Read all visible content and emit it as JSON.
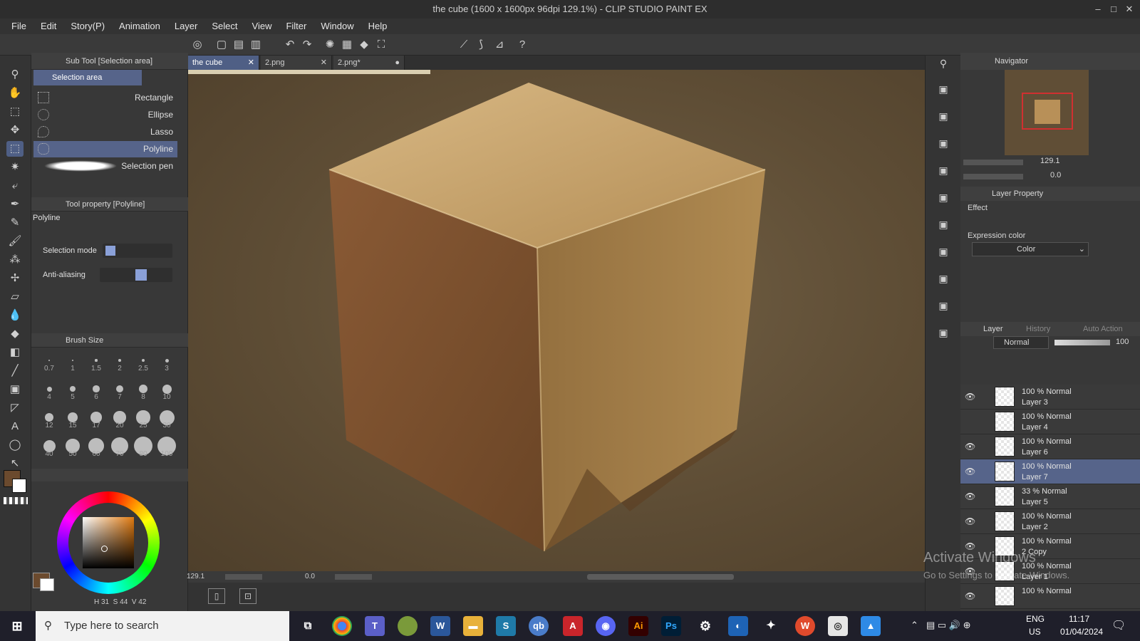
{
  "window": {
    "title": "the cube (1600 x 1600px 96dpi 129.1%)  - CLIP STUDIO PAINT EX",
    "controls": [
      "–",
      "□",
      "✕"
    ]
  },
  "menu": [
    "File",
    "Edit",
    "Story(P)",
    "Animation",
    "Layer",
    "Select",
    "View",
    "Filter",
    "Window",
    "Help"
  ],
  "subtool_panel": {
    "header": "Sub Tool [Selection area]",
    "group_tab": "Selection area",
    "items": [
      "Rectangle",
      "Ellipse",
      "Lasso",
      "Polyline",
      "Selection pen"
    ],
    "selected_index": 3
  },
  "tool_property": {
    "header": "Tool property [Polyline]",
    "tool_name": "Polyline",
    "selection_mode_label": "Selection mode",
    "anti_aliasing_label": "Anti-aliasing"
  },
  "brush_size": {
    "header": "Brush Size",
    "sizes": [
      "0.7",
      "1",
      "1.5",
      "2",
      "2.5",
      "3",
      "4",
      "5",
      "6",
      "7",
      "8",
      "10",
      "12",
      "15",
      "17",
      "20",
      "25",
      "30",
      "40",
      "50",
      "60",
      "70",
      "80",
      "100"
    ]
  },
  "color": {
    "main": "#6b4a2e",
    "sub": "#ffffff",
    "readout_h": "31",
    "readout_s": "44",
    "readout_v": "42"
  },
  "doc_tabs": [
    {
      "label": "the cube",
      "close": "✕",
      "active": true
    },
    {
      "label": "2.png",
      "close": "✕",
      "active": false
    },
    {
      "label": "2.png*",
      "close": "●",
      "active": false
    }
  ],
  "canvas_status": {
    "zoom": "129.1",
    "rotation": "0.0"
  },
  "navigator": {
    "header": "Navigator",
    "zoom": "129.1",
    "rotation": "0.0"
  },
  "layer_property": {
    "header": "Layer Property",
    "effect_label": "Effect",
    "expression_color_label": "Expression color",
    "expression_color_value": "Color"
  },
  "layer_panel": {
    "tabs": [
      "Layer",
      "History",
      "Auto Action"
    ],
    "blend_mode": "Normal",
    "opacity": "100",
    "layers": [
      {
        "opacity_mode": "100 % Normal",
        "name": "Layer 3",
        "visible": true
      },
      {
        "opacity_mode": "100 % Normal",
        "name": "Layer 4",
        "visible": false
      },
      {
        "opacity_mode": "100 % Normal",
        "name": "Layer 6",
        "visible": true
      },
      {
        "opacity_mode": "100 % Normal",
        "name": "Layer 7",
        "visible": true
      },
      {
        "opacity_mode": "33 % Normal",
        "name": "Layer 5",
        "visible": true
      },
      {
        "opacity_mode": "100 % Normal",
        "name": "Layer 2",
        "visible": true
      },
      {
        "opacity_mode": "100 % Normal",
        "name": "2 Copy",
        "visible": true
      },
      {
        "opacity_mode": "100 % Normal",
        "name": "Layer 1",
        "visible": true
      },
      {
        "opacity_mode": "100 % Normal",
        "name": "",
        "visible": true
      }
    ],
    "selected_index": 3
  },
  "watermark": {
    "line1": "Activate Windows",
    "line2": "Go to Settings to activate Windows."
  },
  "taskbar": {
    "search_placeholder": "Type here to search",
    "apps": [
      "W",
      "A",
      "Ai",
      "Ps"
    ],
    "lang1": "ENG",
    "lang2": "US",
    "time": "11:17",
    "date": "01/04/2024"
  }
}
